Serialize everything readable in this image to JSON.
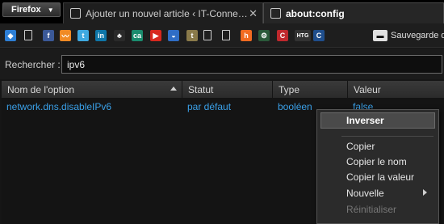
{
  "browser": {
    "menu_button": "Firefox",
    "tabs": [
      {
        "title": "Ajouter un nouvel article ‹ IT-Conne…",
        "active": false
      },
      {
        "title": "about:config",
        "active": true
      }
    ],
    "tab_close_glyph": "✕"
  },
  "bookmarks": {
    "icons": [
      {
        "name": "dropbox-icon",
        "glyph": "◆",
        "color": "#2d7fd6"
      },
      {
        "name": "page-icon",
        "glyph": "",
        "color": ""
      },
      {
        "name": "facebook-icon",
        "glyph": "f",
        "color": "#3b5998"
      },
      {
        "name": "analytics-icon",
        "glyph": "〰",
        "color": "#f08a24"
      },
      {
        "name": "twitter-icon",
        "glyph": "t",
        "color": "#3fa9e0"
      },
      {
        "name": "linkedin-icon",
        "glyph": "in",
        "color": "#0e76a8"
      },
      {
        "name": "bookmark-icon-6",
        "glyph": "♣",
        "color": "#2a2a2a"
      },
      {
        "name": "credit-agricole-icon",
        "glyph": "ca",
        "color": "#1a8c6e"
      },
      {
        "name": "youtube-icon",
        "glyph": "▶",
        "color": "#d8281e"
      },
      {
        "name": "weather-icon",
        "glyph": "◒",
        "color": "#2f6dc6"
      },
      {
        "name": "bookmark-icon-11",
        "glyph": "t",
        "color": "#8a7a4a"
      },
      {
        "name": "page-icon-2",
        "glyph": "",
        "color": ""
      },
      {
        "name": "page-icon-3",
        "glyph": "",
        "color": ""
      },
      {
        "name": "hootsuite-icon",
        "glyph": "h",
        "color": "#f26b21"
      },
      {
        "name": "bookmark-icon-15",
        "glyph": "⚙",
        "color": "#2a5a3a"
      },
      {
        "name": "bookmark-icon-16",
        "glyph": "C",
        "color": "#c0282d"
      },
      {
        "name": "htg-icon",
        "glyph": "HTG",
        "color": "#333333"
      },
      {
        "name": "bookmark-icon-18",
        "glyph": "C",
        "color": "#1f4e8c"
      },
      {
        "name": "toggle-icon",
        "glyph": "▬",
        "color": "#e0e0e0"
      }
    ],
    "last_label": "Sauvegarde de"
  },
  "search": {
    "label": "Rechercher :",
    "value": "ipv6"
  },
  "table": {
    "columns": [
      "Nom de l'option",
      "Statut",
      "Type",
      "Valeur"
    ],
    "sorted_column": 0,
    "rows": [
      {
        "name": "network.dns.disableIPv6",
        "status": "par défaut",
        "type": "booléen",
        "value": "false"
      }
    ],
    "row_color": "#3aa0e8"
  },
  "context_menu": {
    "items": [
      {
        "label": "Inverser",
        "state": "selected"
      },
      {
        "label": "Copier",
        "state": "normal"
      },
      {
        "label": "Copier le nom",
        "state": "normal"
      },
      {
        "label": "Copier la valeur",
        "state": "normal"
      },
      {
        "label": "Nouvelle",
        "state": "submenu"
      },
      {
        "label": "Réinitialiser",
        "state": "disabled"
      }
    ]
  }
}
